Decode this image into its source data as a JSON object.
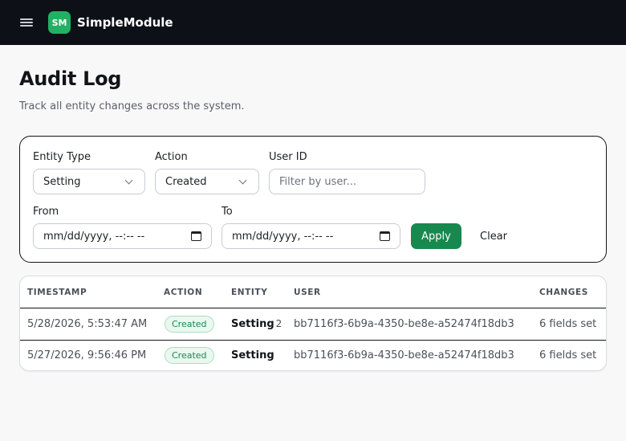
{
  "app": {
    "brand_badge": "SM",
    "brand_name": "SimpleModule"
  },
  "page": {
    "title": "Audit Log",
    "subtitle": "Track all entity changes across the system."
  },
  "filters": {
    "entity_type_label": "Entity Type",
    "entity_type_value": "Setting",
    "action_label": "Action",
    "action_value": "Created",
    "user_id_label": "User ID",
    "user_id_placeholder": "Filter by user...",
    "from_label": "From",
    "from_value": "mm/dd/yyyy, --:-- --",
    "to_label": "To",
    "to_value": "mm/dd/yyyy, --:-- --",
    "apply_label": "Apply",
    "clear_label": "Clear"
  },
  "table": {
    "headers": [
      "TIMESTAMP",
      "ACTION",
      "ENTITY",
      "USER",
      "CHANGES"
    ],
    "rows": [
      {
        "timestamp": "5/28/2026, 5:53:47 AM",
        "action": "Created",
        "entity": "Setting",
        "entity_version": "2",
        "user": "bb7116f3-6b9a-4350-be8e-a52474f18db3",
        "changes": "6 fields set"
      },
      {
        "timestamp": "5/27/2026, 9:56:46 PM",
        "action": "Created",
        "entity": "Setting",
        "entity_version": "",
        "user": "bb7116f3-6b9a-4350-be8e-a52474f18db3",
        "changes": "6 fields set"
      }
    ]
  },
  "colors": {
    "topbar": "#0d1117",
    "brand_accent": "#22b163",
    "apply_button": "#17894e",
    "badge_text": "#17894e"
  }
}
